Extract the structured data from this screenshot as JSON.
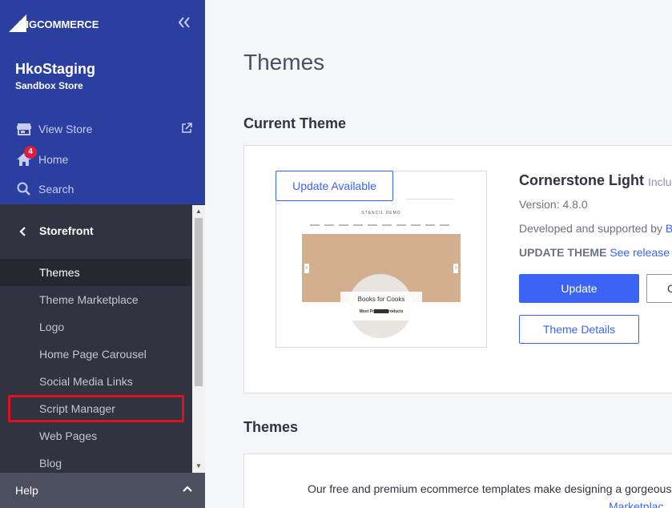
{
  "brand": {
    "logo_text": "BIGCOMMERCE"
  },
  "store": {
    "name": "HkoStaging",
    "subtitle": "Sandbox Store"
  },
  "top_nav": [
    {
      "label": "View Store",
      "icon": "storefront-icon"
    },
    {
      "label": "Home",
      "icon": "home-icon",
      "badge": "4"
    },
    {
      "label": "Search",
      "icon": "search-icon"
    }
  ],
  "section": {
    "label": "Storefront"
  },
  "nav_items": [
    {
      "label": "Themes",
      "active": true
    },
    {
      "label": "Theme Marketplace"
    },
    {
      "label": "Logo"
    },
    {
      "label": "Home Page Carousel"
    },
    {
      "label": "Social Media Links"
    },
    {
      "label": "Script Manager",
      "highlighted": true
    },
    {
      "label": "Web Pages"
    },
    {
      "label": "Blog"
    }
  ],
  "help": {
    "label": "Help"
  },
  "main": {
    "title": "Themes",
    "current_theme_heading": "Current Theme",
    "themes_heading": "Themes",
    "update_available_label": "Update Available",
    "theme": {
      "name": "Cornerstone Light",
      "included_text": "Inclu",
      "version": "Version: 4.8.0",
      "developed_prefix": "Developed and supported by ",
      "developed_link": "B",
      "update_theme_label": "UPDATE THEME",
      "release_link": "See release no"
    },
    "buttons": {
      "update": "Update",
      "secondary": "C",
      "details": "Theme Details"
    },
    "preview": {
      "brand": "STENCIL DEMO",
      "hero_text": "Books for Cooks",
      "popular": "Most Popular Products"
    },
    "promo_text": "Our free and premium ecommerce templates make designing a gorgeous",
    "promo_link": "Marketplac"
  },
  "colors": {
    "sidebar_top": "#2b3fa0",
    "sidebar_bottom": "#313440",
    "accent": "#3c64f4",
    "badge": "#d9213f",
    "highlight": "#e01020"
  }
}
